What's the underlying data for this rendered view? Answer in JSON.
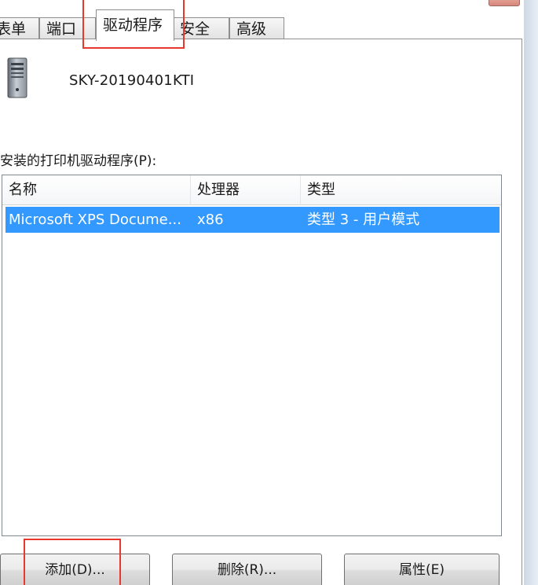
{
  "tabs": [
    {
      "label": "表单",
      "active": false
    },
    {
      "label": "端口",
      "active": false
    },
    {
      "label": "驱动程序",
      "active": true
    },
    {
      "label": "安全",
      "active": false
    },
    {
      "label": "高级",
      "active": false
    }
  ],
  "tab_partial_label": "表单",
  "printer": {
    "name": "SKY-20190401KTI",
    "icon": "computer-tower-icon"
  },
  "drivers_label": "安装的打印机驱动程序(P):",
  "list": {
    "columns": [
      "名称",
      "处理器",
      "类型"
    ],
    "rows": [
      {
        "name": "Microsoft XPS Docume...",
        "processor": "x86",
        "type": "类型 3 - 用户模式",
        "selected": true
      }
    ]
  },
  "buttons": {
    "add": "添加(D)...",
    "remove": "删除(R)...",
    "properties": "属性(E)"
  },
  "colors": {
    "selection": "#3399ff",
    "highlight_box": "#e8382e"
  }
}
